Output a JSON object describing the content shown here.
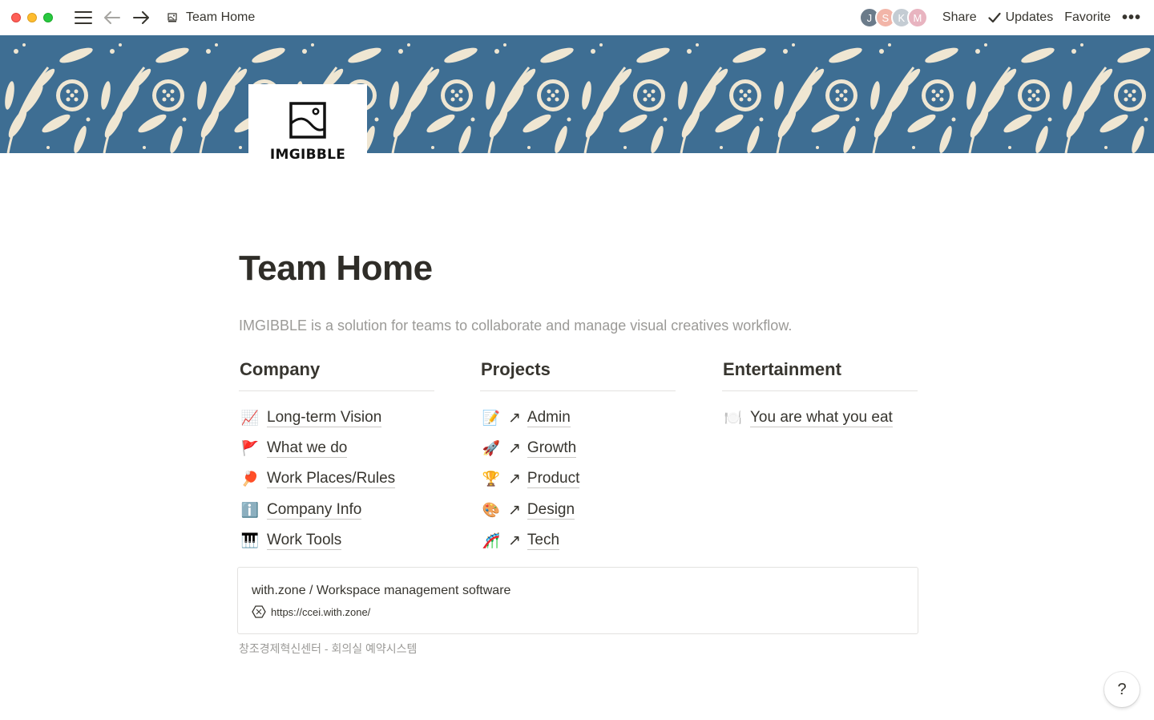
{
  "window": {
    "title": "Team Home"
  },
  "topbar": {
    "collaborators": [
      {
        "initial": "J",
        "color": "#6b7b8a"
      },
      {
        "initial": "S",
        "color": "#f2b5a8"
      },
      {
        "initial": "K",
        "color": "#c4ccd3"
      },
      {
        "initial": "M",
        "color": "#e8b4c0"
      }
    ],
    "share_label": "Share",
    "updates_label": "Updates",
    "favorite_label": "Favorite",
    "more_label": "•••"
  },
  "logo": {
    "text": "IMGIBBLE"
  },
  "page": {
    "title": "Team Home",
    "subtitle": "IMGIBBLE is a solution for teams to collaborate and manage visual creatives workflow."
  },
  "columns": [
    {
      "heading": "Company",
      "items": [
        {
          "emoji": "📈",
          "label": "Long-term Vision",
          "linked": false
        },
        {
          "emoji": "🚩",
          "label": "What we do",
          "linked": false
        },
        {
          "emoji": "🏓",
          "label": "Work Places/Rules",
          "linked": false
        },
        {
          "emoji": "ℹ️",
          "label": "Company Info",
          "linked": false
        },
        {
          "emoji": "🎹",
          "label": "Work Tools",
          "linked": false
        }
      ]
    },
    {
      "heading": "Projects",
      "items": [
        {
          "emoji": "📝",
          "label": "Admin",
          "linked": true
        },
        {
          "emoji": "🚀",
          "label": "Growth",
          "linked": true
        },
        {
          "emoji": "🏆",
          "label": "Product",
          "linked": true
        },
        {
          "emoji": "🎨",
          "label": "Design",
          "linked": true
        },
        {
          "emoji": "🎢",
          "label": "Tech",
          "linked": true
        }
      ]
    },
    {
      "heading": "Entertainment",
      "items": [
        {
          "emoji": "🍽️",
          "label": "You are what you eat",
          "linked": false
        }
      ]
    }
  ],
  "link_arrow": "↗",
  "bookmark": {
    "title": "with.zone / Workspace management software",
    "url": "https://ccei.with.zone/"
  },
  "caption": "창조경제혁신센터 - 회의실 예약시스템",
  "help_label": "?",
  "colors": {
    "cover_blue": "#3e6e93",
    "cover_cream": "#efe6d2"
  }
}
